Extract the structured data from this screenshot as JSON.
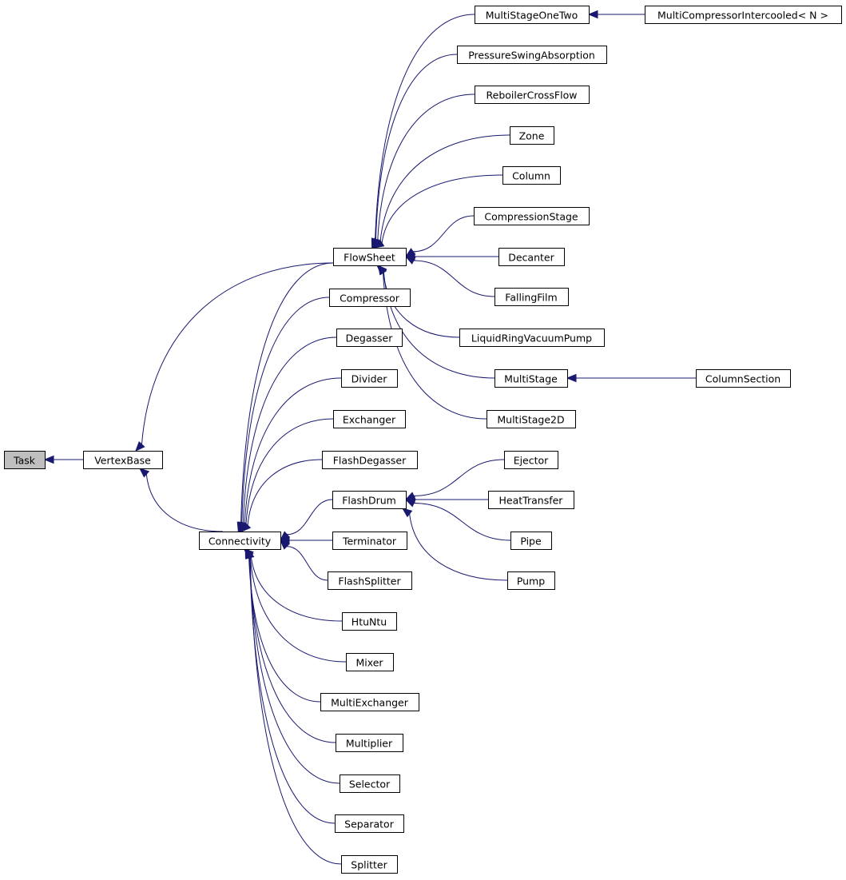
{
  "diagram": {
    "type": "class-inheritance-graph",
    "colors": {
      "edge": "#191970",
      "root_fill": "#bfbfbf",
      "node_fill": "#ffffff",
      "node_border": "#000000"
    },
    "nodes": [
      {
        "id": "Task",
        "label": "Task",
        "root": true
      },
      {
        "id": "VertexBase",
        "label": "VertexBase"
      },
      {
        "id": "FlowSheet",
        "label": "FlowSheet"
      },
      {
        "id": "Connectivity",
        "label": "Connectivity"
      },
      {
        "id": "MultiStageOneTwo",
        "label": "MultiStageOneTwo"
      },
      {
        "id": "MultiCompressorIntercooled",
        "label": "MultiCompressorIntercooled< N >"
      },
      {
        "id": "PressureSwingAbsorption",
        "label": "PressureSwingAbsorption"
      },
      {
        "id": "ReboilerCrossFlow",
        "label": "ReboilerCrossFlow"
      },
      {
        "id": "Zone",
        "label": "Zone"
      },
      {
        "id": "Column",
        "label": "Column"
      },
      {
        "id": "CompressionStage",
        "label": "CompressionStage"
      },
      {
        "id": "Decanter",
        "label": "Decanter"
      },
      {
        "id": "FallingFilm",
        "label": "FallingFilm"
      },
      {
        "id": "LiquidRingVacuumPump",
        "label": "LiquidRingVacuumPump"
      },
      {
        "id": "MultiStage",
        "label": "MultiStage"
      },
      {
        "id": "ColumnSection",
        "label": "ColumnSection"
      },
      {
        "id": "MultiStage2D",
        "label": "MultiStage2D"
      },
      {
        "id": "Compressor",
        "label": "Compressor"
      },
      {
        "id": "Degasser",
        "label": "Degasser"
      },
      {
        "id": "Divider",
        "label": "Divider"
      },
      {
        "id": "Exchanger",
        "label": "Exchanger"
      },
      {
        "id": "FlashDegasser",
        "label": "FlashDegasser"
      },
      {
        "id": "FlashDrum",
        "label": "FlashDrum"
      },
      {
        "id": "Ejector",
        "label": "Ejector"
      },
      {
        "id": "HeatTransfer",
        "label": "HeatTransfer"
      },
      {
        "id": "Pipe",
        "label": "Pipe"
      },
      {
        "id": "Pump",
        "label": "Pump"
      },
      {
        "id": "Terminator",
        "label": "Terminator"
      },
      {
        "id": "FlashSplitter",
        "label": "FlashSplitter"
      },
      {
        "id": "HtuNtu",
        "label": "HtuNtu"
      },
      {
        "id": "Mixer",
        "label": "Mixer"
      },
      {
        "id": "MultiExchanger",
        "label": "MultiExchanger"
      },
      {
        "id": "Multiplier",
        "label": "Multiplier"
      },
      {
        "id": "Selector",
        "label": "Selector"
      },
      {
        "id": "Separator",
        "label": "Separator"
      },
      {
        "id": "Splitter",
        "label": "Splitter"
      }
    ],
    "edges": [
      {
        "from": "VertexBase",
        "to": "Task"
      },
      {
        "from": "FlowSheet",
        "to": "VertexBase"
      },
      {
        "from": "Connectivity",
        "to": "VertexBase"
      },
      {
        "from": "MultiStageOneTwo",
        "to": "FlowSheet"
      },
      {
        "from": "PressureSwingAbsorption",
        "to": "FlowSheet"
      },
      {
        "from": "ReboilerCrossFlow",
        "to": "FlowSheet"
      },
      {
        "from": "Zone",
        "to": "FlowSheet"
      },
      {
        "from": "Column",
        "to": "FlowSheet"
      },
      {
        "from": "CompressionStage",
        "to": "FlowSheet"
      },
      {
        "from": "Decanter",
        "to": "FlowSheet"
      },
      {
        "from": "FallingFilm",
        "to": "FlowSheet"
      },
      {
        "from": "LiquidRingVacuumPump",
        "to": "FlowSheet"
      },
      {
        "from": "MultiStage",
        "to": "FlowSheet"
      },
      {
        "from": "MultiStage2D",
        "to": "FlowSheet"
      },
      {
        "from": "MultiCompressorIntercooled",
        "to": "MultiStageOneTwo"
      },
      {
        "from": "ColumnSection",
        "to": "MultiStage"
      },
      {
        "from": "FlowSheet",
        "to": "Connectivity"
      },
      {
        "from": "Compressor",
        "to": "Connectivity"
      },
      {
        "from": "Degasser",
        "to": "Connectivity"
      },
      {
        "from": "Divider",
        "to": "Connectivity"
      },
      {
        "from": "Exchanger",
        "to": "Connectivity"
      },
      {
        "from": "FlashDegasser",
        "to": "Connectivity"
      },
      {
        "from": "FlashDrum",
        "to": "Connectivity"
      },
      {
        "from": "Terminator",
        "to": "Connectivity"
      },
      {
        "from": "FlashSplitter",
        "to": "Connectivity"
      },
      {
        "from": "HtuNtu",
        "to": "Connectivity"
      },
      {
        "from": "Mixer",
        "to": "Connectivity"
      },
      {
        "from": "MultiExchanger",
        "to": "Connectivity"
      },
      {
        "from": "Multiplier",
        "to": "Connectivity"
      },
      {
        "from": "Selector",
        "to": "Connectivity"
      },
      {
        "from": "Separator",
        "to": "Connectivity"
      },
      {
        "from": "Splitter",
        "to": "Connectivity"
      },
      {
        "from": "Ejector",
        "to": "FlashDrum"
      },
      {
        "from": "HeatTransfer",
        "to": "FlashDrum"
      },
      {
        "from": "Pipe",
        "to": "FlashDrum"
      },
      {
        "from": "Pump",
        "to": "FlashDrum"
      }
    ]
  }
}
